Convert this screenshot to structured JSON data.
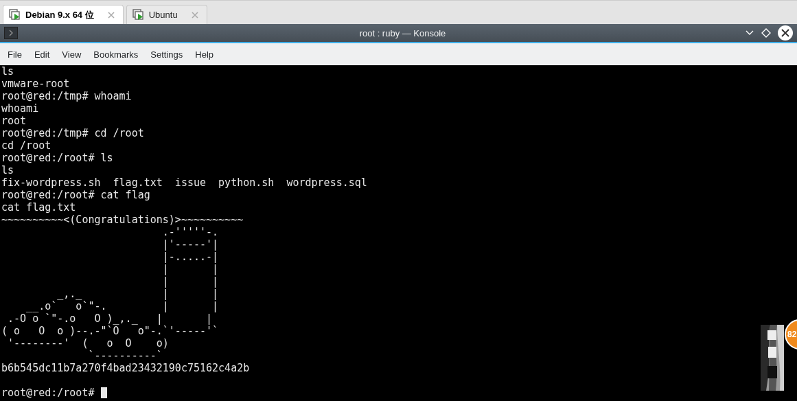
{
  "tabs": [
    {
      "label": "Debian 9.x 64 位",
      "selected": true
    },
    {
      "label": "Ubuntu",
      "selected": false
    }
  ],
  "window": {
    "title": "root : ruby — Konsole"
  },
  "menu": [
    "File",
    "Edit",
    "View",
    "Bookmarks",
    "Settings",
    "Help"
  ],
  "terminal": {
    "lines": [
      "ls",
      "vmware-root",
      "root@red:/tmp# whoami",
      "whoami",
      "root",
      "root@red:/tmp# cd /root",
      "cd /root",
      "root@red:/root# ls",
      "ls",
      "fix-wordpress.sh  flag.txt  issue  python.sh  wordpress.sql",
      "root@red:/root# cat flag",
      "cat flag.txt",
      "~~~~~~~~~~<(Congratulations)>~~~~~~~~~~",
      "                          .-'''''-.",
      "                          |'-----'|",
      "                          |-.....-|",
      "                          |       |",
      "                          |       |",
      "         _,._             |       |",
      "    __.o`   o`\"-.         |       |",
      " .-O o `\"-.o   O )_,._   |       |",
      "( o   O  o )--.-\"`O   o\"-.`'-----'`",
      " '--------'  (   o  O    o)",
      "              `----------`",
      "b6b545dc11b7a270f4bad23432190c75162c4a2b"
    ],
    "prompt": "root@red:/root# ",
    "cursor": true
  },
  "overlay": {
    "badge": "82"
  }
}
